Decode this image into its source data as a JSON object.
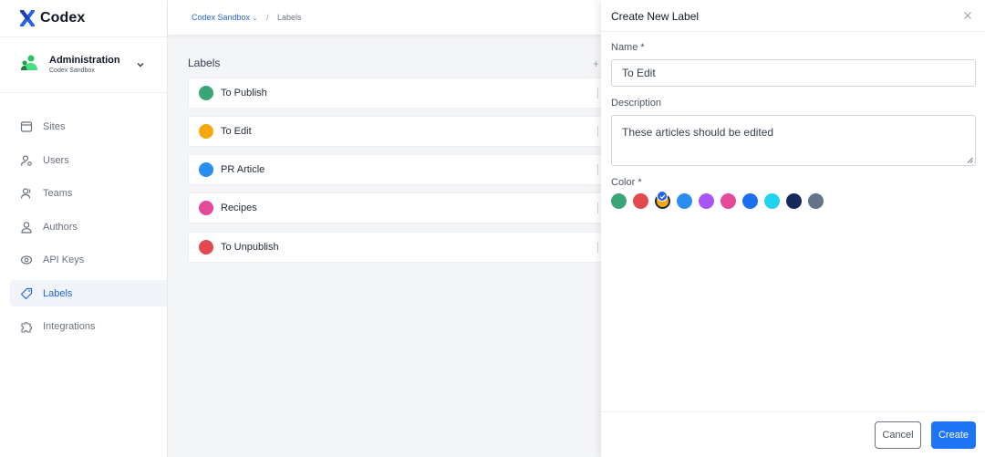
{
  "app": {
    "name": "Codex",
    "brand_color": "#2563eb"
  },
  "org": {
    "name": "Administration",
    "subtitle": "Codex Sandbox"
  },
  "nav": [
    {
      "label": "Sites",
      "icon": "browser-icon",
      "active": false
    },
    {
      "label": "Users",
      "icon": "user-cog-icon",
      "active": false
    },
    {
      "label": "Teams",
      "icon": "team-icon",
      "active": false
    },
    {
      "label": "Authors",
      "icon": "person-icon",
      "active": false
    },
    {
      "label": "API Keys",
      "icon": "api-icon",
      "active": true
    },
    {
      "label": "Labels",
      "icon": "tag-icon",
      "active": true
    },
    {
      "label": "Integrations",
      "icon": "puzzle-icon",
      "active": false
    }
  ],
  "breadcrumb": {
    "workspace": "Codex Sandbox",
    "separator": "/",
    "current": "Labels"
  },
  "labels_section": {
    "title": "Labels",
    "add_symbol": "+",
    "items": [
      {
        "name": "To Publish",
        "color": "#3aa676"
      },
      {
        "name": "To Edit",
        "color": "#f5a70f"
      },
      {
        "name": "PR Article",
        "color": "#2a8ef0"
      },
      {
        "name": "Recipes",
        "color": "#e34a9b"
      },
      {
        "name": "To Unpublish",
        "color": "#e34a4f"
      }
    ]
  },
  "panel": {
    "title": "Create New Label",
    "name_label": "Name *",
    "name_value": "To Edit",
    "description_label": "Description",
    "description_value": "These articles should be edited",
    "color_label": "Color *",
    "selected_color": "#f5a70f",
    "colors": [
      "#3aa676",
      "#e34a4f",
      "#f5a70f",
      "#2a8ef0",
      "#a855f7",
      "#e34a9b",
      "#1d6ff2",
      "#22d3ee",
      "#16295c",
      "#64748b"
    ],
    "cancel_label": "Cancel",
    "create_label": "Create"
  }
}
